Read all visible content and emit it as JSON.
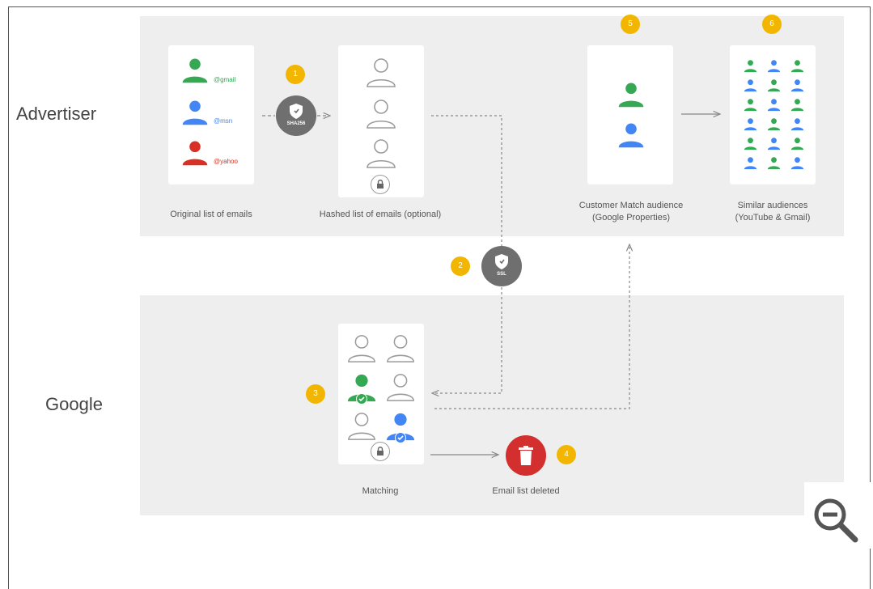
{
  "rows": {
    "advertiser": "Advertiser",
    "google": "Google"
  },
  "steps": [
    "1",
    "2",
    "3",
    "4",
    "5",
    "6"
  ],
  "emails": {
    "gmail": "@gmail",
    "msn": "@msn",
    "yahoo": "@yahoo"
  },
  "shields": {
    "sha256": "SHA256",
    "ssl": "SSL"
  },
  "captions": {
    "original_list": "Original list of emails",
    "hashed_list": "Hashed list of emails (optional)",
    "customer_match_1": "Customer Match audience",
    "customer_match_2": "(Google Properties)",
    "similar_1": "Similar audiences",
    "similar_2": "(YouTube & Gmail)",
    "matching": "Matching",
    "deleted": "Email list deleted"
  },
  "colors": {
    "green": "#34a853",
    "blue": "#4285f4",
    "red": "#d93025",
    "yellow": "#f2b600",
    "grey": "#6f6f6f",
    "band": "#eeeeee"
  },
  "icons": [
    "person-icon",
    "shield-icon",
    "lock-icon",
    "trash-icon",
    "check-icon",
    "zoom-out-icon"
  ]
}
